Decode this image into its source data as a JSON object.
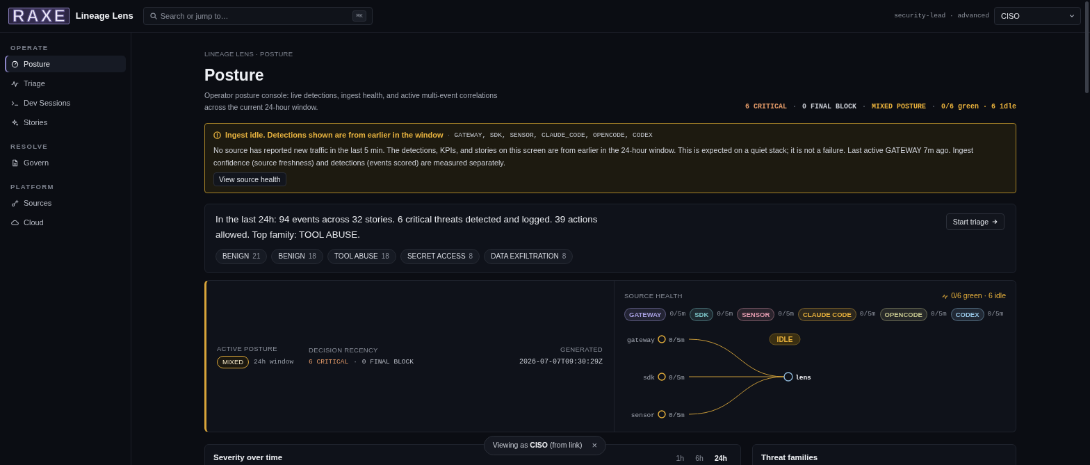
{
  "topbar": {
    "logo": "RAXE",
    "app_name": "Lineage Lens",
    "search": {
      "placeholder": "Search or jump to…",
      "shortcut": "⌘K"
    },
    "user": "security-lead · advanced",
    "role_select": {
      "value": "CISO"
    }
  },
  "sidebar": {
    "sections": [
      {
        "label": "OPERATE",
        "items": [
          {
            "label": "Posture",
            "selected": true
          },
          {
            "label": "Triage",
            "selected": false
          },
          {
            "label": "Dev Sessions",
            "selected": false
          },
          {
            "label": "Stories",
            "selected": false
          }
        ]
      },
      {
        "label": "RESOLVE",
        "items": [
          {
            "label": "Govern",
            "selected": false
          }
        ]
      },
      {
        "label": "PLATFORM",
        "items": [
          {
            "label": "Sources",
            "selected": false
          },
          {
            "label": "Cloud",
            "selected": false
          }
        ]
      }
    ]
  },
  "header": {
    "breadcrumb": "LINEAGE LENS · POSTURE",
    "title": "Posture",
    "description": "Operator posture console: live detections, ingest health, and active multi-event correlations across the current 24-hour window.",
    "status": {
      "separator": "·",
      "items": [
        {
          "text": "6 CRITICAL",
          "color": "#e39a68"
        },
        {
          "text": "0 FINAL BLOCK",
          "color": "#c9ccd3"
        },
        {
          "text": "MIXED POSTURE",
          "color": "#e8b13c"
        },
        {
          "text": "0/6 green · 6 idle",
          "color": "#e8b13c"
        }
      ]
    }
  },
  "alert": {
    "title": "Ingest idle. Detections shown are from earlier in the window",
    "separator": "·",
    "sources": "GATEWAY, SDK, SENSOR, CLAUDE_CODE, OPENCODE, CODEX",
    "message": "No source has reported new traffic in the last 5 min. The detections, KPIs, and stories on this screen are from earlier in the 24-hour window. This is expected on a quiet stack; it is not a failure. Last active GATEWAY 7m ago. Ingest confidence (source freshness) and detections (events scored) are measured separately.",
    "button": "View source health"
  },
  "summary": {
    "text": "In the last 24h: 94 events across 32 stories. 6 critical threats detected and logged. 39 actions allowed. Top family: TOOL ABUSE.",
    "button": "Start triage",
    "families": [
      {
        "label": "BENIGN",
        "count": "21"
      },
      {
        "label": "BENIGN",
        "count": "18"
      },
      {
        "label": "TOOL ABUSE",
        "count": "18"
      },
      {
        "label": "SECRET ACCESS",
        "count": "8"
      },
      {
        "label": "DATA EXFILTRATION",
        "count": "8"
      }
    ]
  },
  "posture": {
    "active": {
      "label": "ACTIVE POSTURE",
      "badge": "MIXED",
      "window": "24h window"
    },
    "recency": {
      "label": "DECISION RECENCY",
      "separator": "·",
      "items": [
        {
          "text": "6 CRITICAL",
          "critical": true
        },
        {
          "text": "0 FINAL BLOCK",
          "critical": false
        }
      ]
    },
    "generated": {
      "label": "GENERATED",
      "value": "2026-07-07T09:30:29Z"
    }
  },
  "source_health": {
    "label": "SOURCE HEALTH",
    "summary": "0/6 green · 6 idle",
    "sources": [
      {
        "name": "GATEWAY",
        "reading": "0/5m",
        "color": "#a79fe0"
      },
      {
        "name": "SDK",
        "reading": "0/5m",
        "color": "#7fc9cc"
      },
      {
        "name": "SENSOR",
        "reading": "0/5m",
        "color": "#e29aae"
      },
      {
        "name": "CLAUDE CODE",
        "reading": "0/5m",
        "color": "#e8b13c"
      },
      {
        "name": "OPENCODE",
        "reading": "0/5m",
        "color": "#c3c48e"
      },
      {
        "name": "CODEX",
        "reading": "0/5m",
        "color": "#97c6e6"
      }
    ],
    "flow": {
      "inputs": [
        {
          "label": "gateway",
          "reading": "0/5m"
        },
        {
          "label": "sdk",
          "reading": "0/5m"
        },
        {
          "label": "sensor",
          "reading": "0/5m"
        }
      ],
      "target": "lens",
      "badge": "IDLE"
    }
  },
  "severity": {
    "title": "Severity over time",
    "ranges": [
      {
        "label": "1h",
        "selected": false
      },
      {
        "label": "6h",
        "selected": false
      },
      {
        "label": "24h",
        "selected": true
      }
    ]
  },
  "threat_families": {
    "title": "Threat families"
  },
  "toast": {
    "text": "Viewing as **CISO** (from link)",
    "close": "×"
  }
}
